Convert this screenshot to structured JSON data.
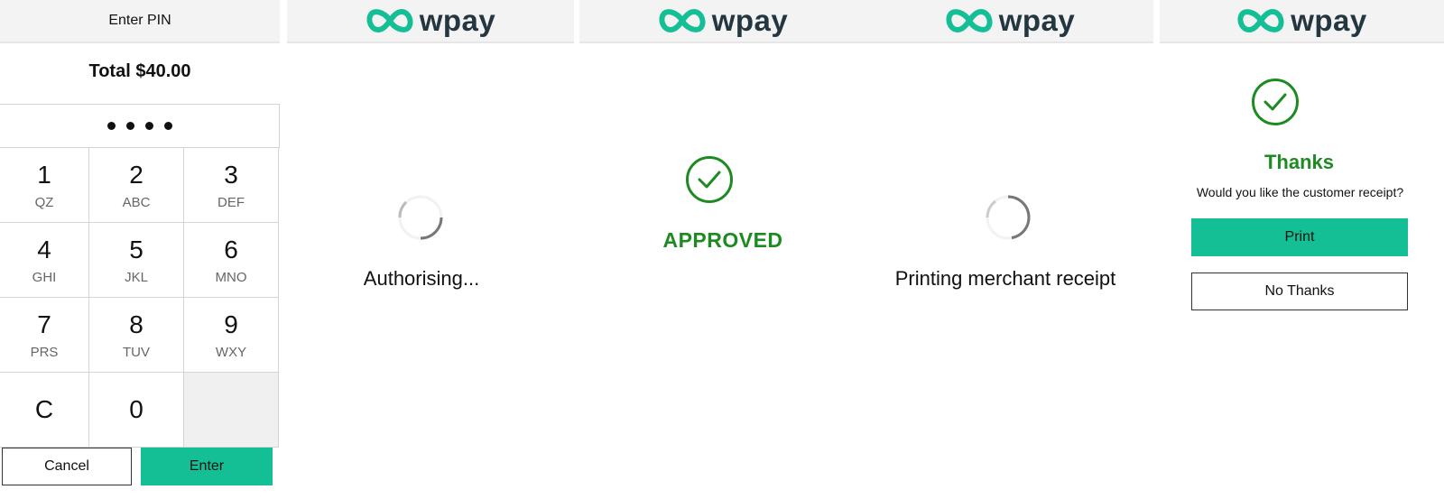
{
  "pin_screen": {
    "header": "Enter PIN",
    "total": "Total $40.00",
    "pin_masked_dots": 4,
    "keys": [
      {
        "number": "1",
        "letters": "QZ"
      },
      {
        "number": "2",
        "letters": "ABC"
      },
      {
        "number": "3",
        "letters": "DEF"
      },
      {
        "number": "4",
        "letters": "GHI"
      },
      {
        "number": "5",
        "letters": "JKL"
      },
      {
        "number": "6",
        "letters": "MNO"
      },
      {
        "number": "7",
        "letters": "PRS"
      },
      {
        "number": "8",
        "letters": "TUV"
      },
      {
        "number": "9",
        "letters": "WXY"
      },
      {
        "number": "C",
        "letters": ""
      },
      {
        "number": "0",
        "letters": ""
      },
      {
        "number": "",
        "letters": ""
      }
    ],
    "cancel_label": "Cancel",
    "enter_label": "Enter"
  },
  "brand": {
    "name": "wpay",
    "logo_icon": "wpay-infinity-icon",
    "primary_color": "#14bf96",
    "text_color": "#243640",
    "success_color": "#1e8a22"
  },
  "authorising_screen": {
    "status": "Authorising..."
  },
  "approved_screen": {
    "status": "APPROVED",
    "icon": "check-circle-icon"
  },
  "printing_screen": {
    "status": "Printing merchant receipt"
  },
  "receipt_screen": {
    "icon": "check-circle-icon",
    "title": "Thanks",
    "question": "Would you like the customer receipt?",
    "print_label": "Print",
    "no_thanks_label": "No Thanks"
  }
}
